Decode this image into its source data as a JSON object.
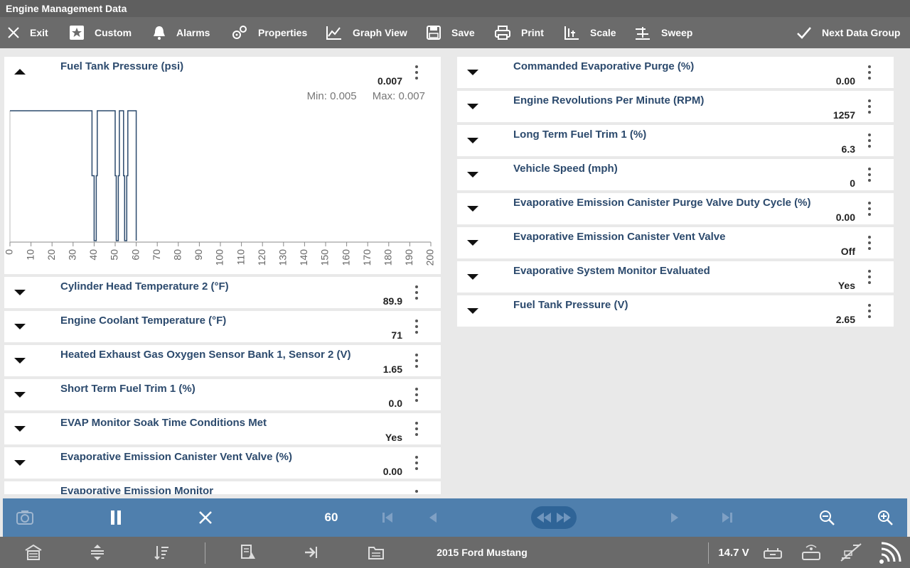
{
  "window": {
    "title": "Engine Management Data"
  },
  "toolbar": {
    "exit": "Exit",
    "custom": "Custom",
    "alarms": "Alarms",
    "properties": "Properties",
    "graph_view": "Graph View",
    "save": "Save",
    "print": "Print",
    "scale": "Scale",
    "sweep": "Sweep",
    "next_group": "Next Data Group"
  },
  "graph_pid": {
    "name": "Fuel Tank Pressure (psi)",
    "value": "0.007",
    "min_label": "Min: 0.005",
    "max_label": "Max: 0.007"
  },
  "chart_data": {
    "type": "line",
    "x_ticks": [
      "0",
      "10",
      "20",
      "30",
      "40",
      "50",
      "60",
      "70",
      "80",
      "90",
      "100",
      "110",
      "120",
      "130",
      "140",
      "150",
      "160",
      "170",
      "180",
      "190",
      "200"
    ],
    "xlim": [
      0,
      200
    ],
    "ylim": [
      0.005,
      0.007
    ],
    "series": [
      {
        "points": [
          [
            0,
            0.007
          ],
          [
            39,
            0.007
          ],
          [
            39,
            0.006
          ],
          [
            40,
            0.006
          ],
          [
            40,
            0.005
          ],
          [
            41,
            0.005
          ],
          [
            41,
            0.006
          ],
          [
            41.5,
            0.006
          ],
          [
            41.5,
            0.007
          ],
          [
            50,
            0.007
          ],
          [
            50,
            0.006
          ],
          [
            50.5,
            0.006
          ],
          [
            50.5,
            0.005
          ],
          [
            51.5,
            0.005
          ],
          [
            51.5,
            0.006
          ],
          [
            52,
            0.006
          ],
          [
            52,
            0.007
          ],
          [
            54,
            0.007
          ],
          [
            54,
            0.006
          ],
          [
            54.5,
            0.006
          ],
          [
            54.5,
            0.005
          ],
          [
            55.5,
            0.005
          ],
          [
            55.5,
            0.006
          ],
          [
            56,
            0.006
          ],
          [
            56,
            0.007
          ],
          [
            60,
            0.007
          ],
          [
            60,
            0.005
          ]
        ]
      }
    ],
    "line_color": "#2c4a6d"
  },
  "left_items": [
    {
      "name": "Cylinder Head Temperature 2 (°F)",
      "value": "89.9"
    },
    {
      "name": "Engine Coolant Temperature (°F)",
      "value": "71"
    },
    {
      "name": "Heated Exhaust Gas Oxygen Sensor Bank 1, Sensor 2 (V)",
      "value": "1.65"
    },
    {
      "name": "Short Term Fuel Trim 1 (%)",
      "value": "0.0"
    },
    {
      "name": "EVAP Monitor Soak Time Conditions Met",
      "value": "Yes"
    },
    {
      "name": "Evaporative Emission Canister Vent Valve (%)",
      "value": "0.00"
    },
    {
      "name": "Evaporative Emission Monitor",
      "value": ""
    }
  ],
  "right_items": [
    {
      "name": "Commanded Evaporative Purge (%)",
      "value": "0.00"
    },
    {
      "name": "Engine Revolutions Per Minute (RPM)",
      "value": "1257"
    },
    {
      "name": "Long Term Fuel Trim 1 (%)",
      "value": "6.3"
    },
    {
      "name": "Vehicle Speed (mph)",
      "value": "0"
    },
    {
      "name": "Evaporative Emission Canister Purge Valve Duty Cycle (%)",
      "value": "0.00"
    },
    {
      "name": "Evaporative Emission Canister Vent Valve",
      "value": "Off"
    },
    {
      "name": "Evaporative System Monitor Evaluated",
      "value": "Yes"
    },
    {
      "name": "Fuel Tank Pressure (V)",
      "value": "2.65"
    }
  ],
  "controls": {
    "frame_count": "60"
  },
  "status": {
    "vehicle": "2015 Ford Mustang",
    "voltage": "14.7 V"
  },
  "colors": {
    "accent": "#4f7fad",
    "toolbar": "#6b6b6b",
    "title": "#2c4a6d"
  }
}
